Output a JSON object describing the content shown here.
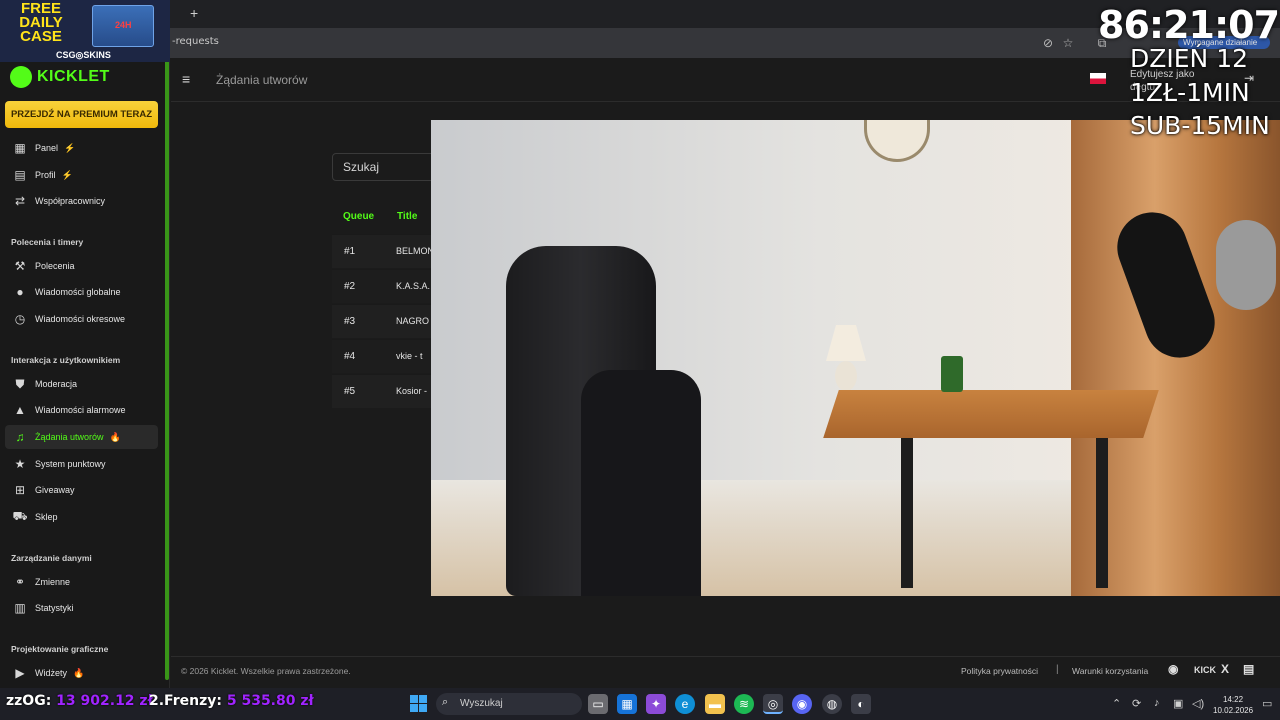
{
  "browser": {
    "new_tab_symbol": "+",
    "url": "-requests"
  },
  "promo": {
    "headline_1": "FREE",
    "headline_2": "DAILY",
    "headline_3": "CASE",
    "box_label": "24H",
    "brand": "CSG◎SKINS"
  },
  "sidebar": {
    "brand": "KICKLET",
    "premium": "PRZEJDŹ NA PREMIUM TERAZ",
    "items": [
      {
        "label": "Panel",
        "icon": "dashboard-icon",
        "badge": "⚡"
      },
      {
        "label": "Profil",
        "icon": "profile-icon",
        "badge": "⚡"
      },
      {
        "label": "Współpracownicy",
        "icon": "collaborators-icon"
      }
    ],
    "sections": [
      {
        "title": "Polecenia i timery",
        "items": [
          {
            "label": "Polecenia",
            "icon": "hammer-icon"
          },
          {
            "label": "Wiadomości globalne",
            "icon": "chat-icon"
          },
          {
            "label": "Wiadomości okresowe",
            "icon": "clock-icon"
          }
        ]
      },
      {
        "title": "Interakcja z użytkownikiem",
        "items": [
          {
            "label": "Moderacja",
            "icon": "shield-icon"
          },
          {
            "label": "Wiadomości alarmowe",
            "icon": "warning-icon"
          },
          {
            "label": "Żądania utworów",
            "icon": "music-icon",
            "badge": "🔥",
            "active": true
          },
          {
            "label": "System punktowy",
            "icon": "star-icon"
          },
          {
            "label": "Giveaway",
            "icon": "gift-icon"
          },
          {
            "label": "Sklep",
            "icon": "cart-icon"
          }
        ]
      },
      {
        "title": "Zarządzanie danymi",
        "items": [
          {
            "label": "Zmienne",
            "icon": "link-icon"
          },
          {
            "label": "Statystyki",
            "icon": "bar-chart-icon"
          }
        ]
      },
      {
        "title": "Projektowanie graficzne",
        "items": [
          {
            "label": "Widżety",
            "icon": "video-icon",
            "badge": "🔥"
          }
        ]
      }
    ]
  },
  "header": {
    "title": "Żądania utworów",
    "editing_line_1": "Edytujesz jako",
    "editing_line_2": "degtu"
  },
  "main": {
    "search_placeholder": "Szukaj",
    "columns": [
      "Queue",
      "Title"
    ],
    "rows": [
      {
        "queue": "#1",
        "title": "BELMON"
      },
      {
        "queue": "#2",
        "title": "K.A.S.A."
      },
      {
        "queue": "#3",
        "title": "NAGRO"
      },
      {
        "queue": "#4",
        "title": "vkie - t"
      },
      {
        "queue": "#5",
        "title": "Kosior -"
      }
    ]
  },
  "overlay": {
    "timer": "86:21:07",
    "day": "DZIEŃ 12",
    "rate_1": "1ZŁ-1MIN",
    "rate_2": "SUB-15MIN",
    "pill": "Wymagane działanie"
  },
  "footer": {
    "copyright": "© 2026 Kicklet. Wszelkie prawa zastrzeżone.",
    "privacy": "Polityka prywatności",
    "separator": "|",
    "terms": "Warunki korzystania",
    "social_kick": "KICK",
    "social_x": "X"
  },
  "taskbar": {
    "stat_1_label": "zzOG:",
    "stat_1_value": "13 902.12 zł",
    "stat_2_label": "2.Frenzy:",
    "stat_2_value": "5 535.80 zł",
    "search_placeholder": "Wyszukaj",
    "time": "14:22",
    "date": "10.02.2026"
  }
}
